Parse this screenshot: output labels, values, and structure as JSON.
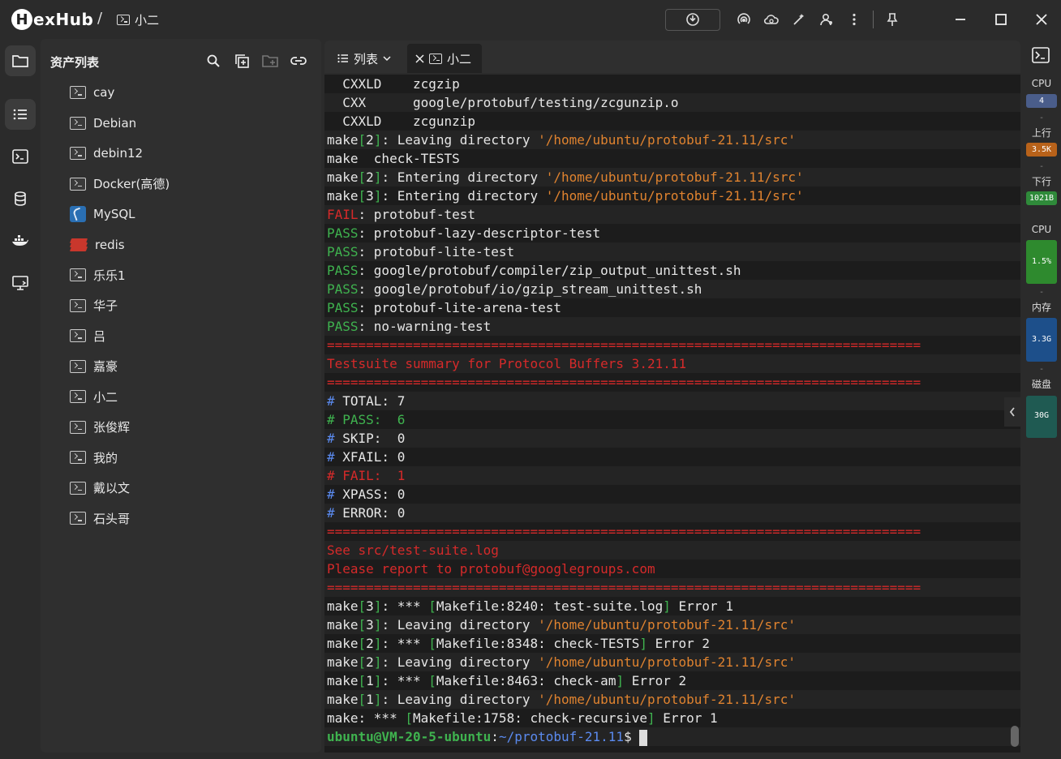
{
  "app": {
    "logo_letter": "H",
    "name": "exHub",
    "separator": "/",
    "current_tab": "小二"
  },
  "assets": {
    "title": "资产列表",
    "items": [
      {
        "label": "cay",
        "icon": "terminal-icon"
      },
      {
        "label": "Debian",
        "icon": "terminal-icon"
      },
      {
        "label": "debin12",
        "icon": "terminal-icon"
      },
      {
        "label": "Docker(高德)",
        "icon": "terminal-icon"
      },
      {
        "label": "MySQL",
        "icon": "mysql-icon"
      },
      {
        "label": "redis",
        "icon": "redis-icon"
      },
      {
        "label": "乐乐1",
        "icon": "terminal-icon"
      },
      {
        "label": "华子",
        "icon": "terminal-icon"
      },
      {
        "label": "吕",
        "icon": "terminal-icon"
      },
      {
        "label": "嘉豪",
        "icon": "terminal-icon"
      },
      {
        "label": "小二",
        "icon": "terminal-icon"
      },
      {
        "label": "张俊辉",
        "icon": "terminal-icon"
      },
      {
        "label": "我的",
        "icon": "terminal-icon"
      },
      {
        "label": "戴以文",
        "icon": "terminal-icon"
      },
      {
        "label": "石头哥",
        "icon": "terminal-icon"
      }
    ]
  },
  "tabs": {
    "list_label": "列表",
    "active_label": "小二"
  },
  "terminal": {
    "lines": [
      [
        [
          "w",
          "  CXXLD    zcgzip"
        ]
      ],
      [
        [
          "w",
          "  CXX      google/protobuf/testing/zcgunzip.o"
        ]
      ],
      [
        [
          "w",
          "  CXXLD    zcgunzip"
        ]
      ],
      [
        [
          "w",
          "make"
        ],
        [
          "g",
          "["
        ],
        [
          "w",
          "2"
        ],
        [
          "g",
          "]"
        ],
        [
          "w",
          ": Leaving directory "
        ],
        [
          "o",
          "'/home/ubuntu/protobuf-21.11/src'"
        ]
      ],
      [
        [
          "w",
          "make  check-TESTS"
        ]
      ],
      [
        [
          "w",
          "make"
        ],
        [
          "g",
          "["
        ],
        [
          "w",
          "2"
        ],
        [
          "g",
          "]"
        ],
        [
          "w",
          ": Entering directory "
        ],
        [
          "o",
          "'/home/ubuntu/protobuf-21.11/src'"
        ]
      ],
      [
        [
          "w",
          "make"
        ],
        [
          "g",
          "["
        ],
        [
          "w",
          "3"
        ],
        [
          "g",
          "]"
        ],
        [
          "w",
          ": Entering directory "
        ],
        [
          "o",
          "'/home/ubuntu/protobuf-21.11/src'"
        ]
      ],
      [
        [
          "r",
          "FAIL"
        ],
        [
          "w",
          ": protobuf-test"
        ]
      ],
      [
        [
          "g",
          "PASS"
        ],
        [
          "w",
          ": protobuf-lazy-descriptor-test"
        ]
      ],
      [
        [
          "g",
          "PASS"
        ],
        [
          "w",
          ": protobuf-lite-test"
        ]
      ],
      [
        [
          "g",
          "PASS"
        ],
        [
          "w",
          ": google/protobuf/compiler/zip_output_unittest.sh"
        ]
      ],
      [
        [
          "g",
          "PASS"
        ],
        [
          "w",
          ": google/protobuf/io/gzip_stream_unittest.sh"
        ]
      ],
      [
        [
          "g",
          "PASS"
        ],
        [
          "w",
          ": protobuf-lite-arena-test"
        ]
      ],
      [
        [
          "g",
          "PASS"
        ],
        [
          "w",
          ": no-warning-test"
        ]
      ],
      [
        [
          "r",
          "============================================================================"
        ]
      ],
      [
        [
          "r",
          "Testsuite summary for Protocol Buffers 3.21.11"
        ]
      ],
      [
        [
          "r",
          "============================================================================"
        ]
      ],
      [
        [
          "b",
          "# "
        ],
        [
          "w",
          "TOTAL: 7"
        ]
      ],
      [
        [
          "g",
          "# PASS:  6"
        ]
      ],
      [
        [
          "b",
          "# "
        ],
        [
          "w",
          "SKIP:  0"
        ]
      ],
      [
        [
          "b",
          "# "
        ],
        [
          "w",
          "XFAIL: 0"
        ]
      ],
      [
        [
          "r",
          "# FAIL:  1"
        ]
      ],
      [
        [
          "b",
          "# "
        ],
        [
          "w",
          "XPASS: 0"
        ]
      ],
      [
        [
          "b",
          "# "
        ],
        [
          "w",
          "ERROR: 0"
        ]
      ],
      [
        [
          "r",
          "============================================================================"
        ]
      ],
      [
        [
          "r",
          "See src/test-suite.log"
        ]
      ],
      [
        [
          "r",
          "Please report to protobuf@googlegroups.com"
        ]
      ],
      [
        [
          "r",
          "============================================================================"
        ]
      ],
      [
        [
          "w",
          "make"
        ],
        [
          "g",
          "["
        ],
        [
          "w",
          "3"
        ],
        [
          "g",
          "]"
        ],
        [
          "w",
          ": *** "
        ],
        [
          "g",
          "["
        ],
        [
          "w",
          "Makefile:8240: test-suite.log"
        ],
        [
          "g",
          "]"
        ],
        [
          "w",
          " Error 1"
        ]
      ],
      [
        [
          "w",
          "make"
        ],
        [
          "g",
          "["
        ],
        [
          "w",
          "3"
        ],
        [
          "g",
          "]"
        ],
        [
          "w",
          ": Leaving directory "
        ],
        [
          "o",
          "'/home/ubuntu/protobuf-21.11/src'"
        ]
      ],
      [
        [
          "w",
          "make"
        ],
        [
          "g",
          "["
        ],
        [
          "w",
          "2"
        ],
        [
          "g",
          "]"
        ],
        [
          "w",
          ": *** "
        ],
        [
          "g",
          "["
        ],
        [
          "w",
          "Makefile:8348: check-TESTS"
        ],
        [
          "g",
          "]"
        ],
        [
          "w",
          " Error 2"
        ]
      ],
      [
        [
          "w",
          "make"
        ],
        [
          "g",
          "["
        ],
        [
          "w",
          "2"
        ],
        [
          "g",
          "]"
        ],
        [
          "w",
          ": Leaving directory "
        ],
        [
          "o",
          "'/home/ubuntu/protobuf-21.11/src'"
        ]
      ],
      [
        [
          "w",
          "make"
        ],
        [
          "g",
          "["
        ],
        [
          "w",
          "1"
        ],
        [
          "g",
          "]"
        ],
        [
          "w",
          ": *** "
        ],
        [
          "g",
          "["
        ],
        [
          "w",
          "Makefile:8463: check-am"
        ],
        [
          "g",
          "]"
        ],
        [
          "w",
          " Error 2"
        ]
      ],
      [
        [
          "w",
          "make"
        ],
        [
          "g",
          "["
        ],
        [
          "w",
          "1"
        ],
        [
          "g",
          "]"
        ],
        [
          "w",
          ": Leaving directory "
        ],
        [
          "o",
          "'/home/ubuntu/protobuf-21.11/src'"
        ]
      ],
      [
        [
          "w",
          "make: *** "
        ],
        [
          "g",
          "["
        ],
        [
          "w",
          "Makefile:1758: check-recursive"
        ],
        [
          "g",
          "]"
        ],
        [
          "w",
          " Error 1"
        ]
      ],
      [
        [
          "gb",
          "ubuntu@VM-20-5-ubuntu"
        ],
        [
          "w",
          ":"
        ],
        [
          "b",
          "~/protobuf-21.11"
        ],
        [
          "w",
          "$ "
        ]
      ]
    ]
  },
  "monitor": {
    "cpu_label": "CPU",
    "cpu_cores": "4",
    "upload_label": "上行",
    "upload_value": "3.5K",
    "download_label": "下行",
    "download_value": "1021B",
    "cpu_usage_label": "CPU",
    "cpu_usage_value": "1.5%",
    "memory_label": "内存",
    "memory_value": "3.3G",
    "disk_label": "磁盘",
    "disk_value": "30G",
    "dash": "-"
  },
  "colors": {
    "accent_green": "#3fb34f",
    "error_red": "#d62a2a",
    "path_orange": "#e0832f",
    "prompt_blue": "#5b8bf0"
  }
}
